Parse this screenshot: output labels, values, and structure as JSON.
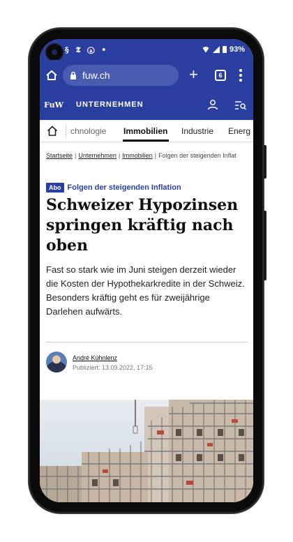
{
  "status_bar": {
    "left_icons": "§ 𝕿 ⓐ •",
    "battery": "93%"
  },
  "browser": {
    "url": "fuw.ch",
    "tab_count": "6"
  },
  "site_header": {
    "logo": "FuW",
    "section": "UNTERNEHMEN"
  },
  "nav": {
    "items": [
      {
        "label": "chnologie"
      },
      {
        "label": "Immobilien",
        "active": true
      },
      {
        "label": "Industrie"
      },
      {
        "label": "Energ"
      }
    ]
  },
  "breadcrumb": {
    "items": [
      "Startseite",
      "Unternehmen",
      "Immobilien"
    ],
    "current": "Folgen der steigenden Inflat"
  },
  "article": {
    "badge": "Abo",
    "kicker": "Folgen der steigenden Inflation",
    "headline": "Schweizer Hypozinsen springen kräftig nach oben",
    "lead": "Fast so stark wie im Juni steigen derzeit wieder die Kosten der Hypothekarkredite in der Schweiz. Besonders kräftig geht es für zweijährige Darlehen aufwärts.",
    "author": "André Kühnlenz",
    "published": "Publiziert: 13.09.2022, 17:15"
  },
  "colors": {
    "brand_blue": "#2a3fa0"
  }
}
